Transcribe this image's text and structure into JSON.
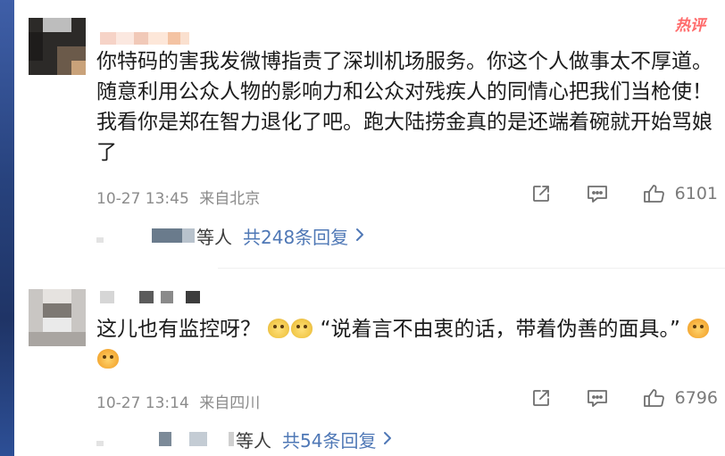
{
  "comments": [
    {
      "text": "你特码的害我发微博指责了深圳机场服务。你这个人做事太不厚道。随意利用公众人物的影响力和公众对残疾人的同情心把我们当枪使！我看你是郑在智力退化了吧。跑大陆捞金真的是还端着碗就开始骂娘了",
      "badge": "热评",
      "date": "10-27 13:45",
      "location": "来自北京",
      "likes": "6101",
      "reply_suffix": "等人",
      "reply_count": "共248条回复",
      "reply_arrow": "›"
    },
    {
      "text_a": "这儿也有监控呀？",
      "text_b": "“说着言不由衷的话，带着伪善的面具。”",
      "emoji_1": "doge-emoji",
      "emoji_2": "tears-emoji",
      "date": "10-27 13:14",
      "location": "来自四川",
      "likes": "6796",
      "reply_suffix": "等人",
      "reply_count": "共54条回复",
      "reply_arrow": "›"
    }
  ],
  "icons": {
    "share": "share-icon",
    "comment": "comment-icon",
    "like": "thumbs-up-icon"
  },
  "colors": {
    "link": "#4f78b6",
    "badge": "#ff6a6a",
    "meta": "#8b8b8b"
  }
}
